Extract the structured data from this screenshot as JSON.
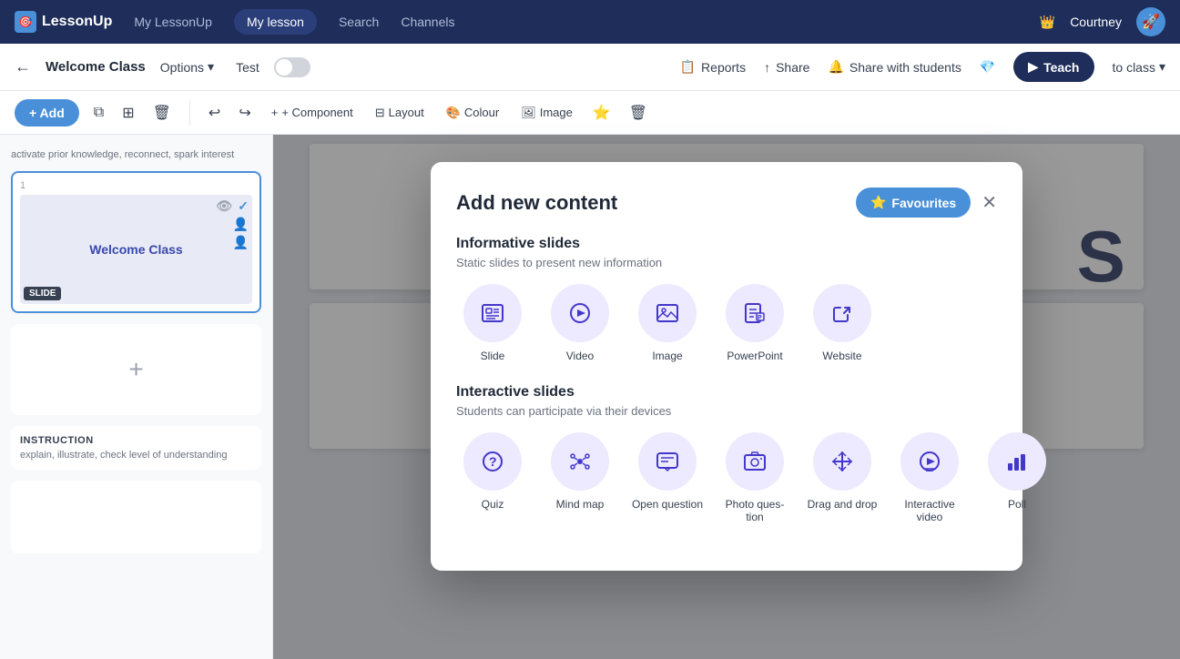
{
  "topnav": {
    "logo_text": "LessonUp",
    "logo_icon": "🎯",
    "links": [
      {
        "label": "My LessonUp",
        "active": false
      },
      {
        "label": "My lesson",
        "active": true
      },
      {
        "label": "Search",
        "active": false
      },
      {
        "label": "Channels",
        "active": false
      }
    ],
    "user_name": "Courtney",
    "crown": "👑",
    "rocket": "🚀"
  },
  "secondary_nav": {
    "lesson_title": "Welcome Class",
    "options_label": "Options",
    "test_label": "Test",
    "reports_label": "Reports",
    "share_label": "Share",
    "share_students_label": "Share with students",
    "teach_label": "Teach",
    "to_class_label": "to class"
  },
  "toolbar": {
    "add_label": "+ Add",
    "component_label": "+ Component",
    "layout_label": "Layout",
    "colour_label": "Colour",
    "image_label": "Image"
  },
  "sidebar": {
    "slide_number": "1",
    "slide_name": "Welcome Class",
    "slide_label": "SLIDE",
    "instruction_title": "INSTRUCTION",
    "instruction_text": "explain, illustrate, check level of understanding"
  },
  "modal": {
    "title": "Add new content",
    "favourites_label": "Favourites",
    "close_icon": "✕",
    "informative_title": "Informative slides",
    "informative_subtitle": "Static slides to present new information",
    "informative_items": [
      {
        "label": "Slide",
        "icon": "⊞"
      },
      {
        "label": "Video",
        "icon": "▶"
      },
      {
        "label": "Image",
        "icon": "🖼"
      },
      {
        "label": "PowerPoint",
        "icon": "📊"
      },
      {
        "label": "Website",
        "icon": "🔗"
      }
    ],
    "interactive_title": "Interactive slides",
    "interactive_subtitle": "Students can participate via their devices",
    "interactive_items": [
      {
        "label": "Quiz",
        "icon": "?"
      },
      {
        "label": "Mind map",
        "icon": "✦"
      },
      {
        "label": "Open question",
        "icon": "💬"
      },
      {
        "label": "Photo question",
        "icon": "📷"
      },
      {
        "label": "Drag and drop",
        "icon": "✦"
      },
      {
        "label": "Interactive video",
        "icon": "▶"
      },
      {
        "label": "Poll",
        "icon": "📊"
      }
    ]
  },
  "canvas": {
    "slide_letter": "S"
  }
}
